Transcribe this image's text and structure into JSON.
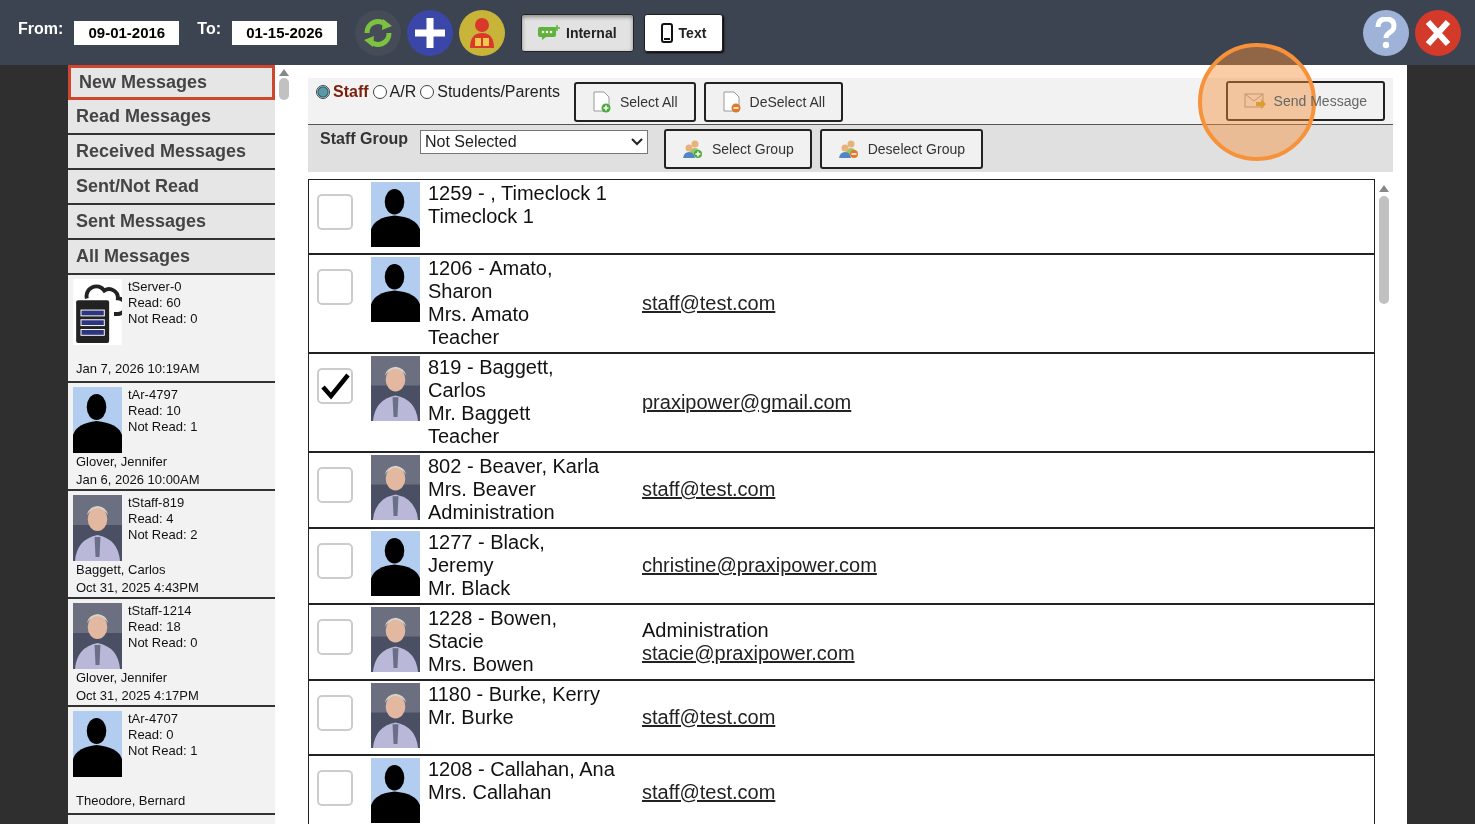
{
  "header": {
    "from_label": "From:",
    "from_date": "09-01-2016",
    "to_label": "To:",
    "to_date": "01-15-2026",
    "modes": [
      {
        "label": "Internal",
        "kind": "chat",
        "selected": true
      },
      {
        "label": "Text",
        "kind": "phone",
        "selected": false
      }
    ]
  },
  "nav": [
    {
      "label": "New Messages",
      "selected": true
    },
    {
      "label": "Read Messages",
      "selected": false
    },
    {
      "label": "Received Messages",
      "selected": false
    },
    {
      "label": "Sent/Not Read",
      "selected": false
    },
    {
      "label": "Sent Messages",
      "selected": false
    },
    {
      "label": "All Messages",
      "selected": false
    }
  ],
  "threads": [
    {
      "kind": "server",
      "id": "tServer-0",
      "read": "Read: 60",
      "not_read": "Not Read: 0",
      "footer": [
        "Jan 7, 2026 10:19AM"
      ]
    },
    {
      "kind": "silhouette",
      "id": "tAr-4797",
      "read": "Read: 10",
      "not_read": "Not Read: 1",
      "footer": [
        "Glover, Jennifer",
        "Jan 6, 2026 10:00AM"
      ]
    },
    {
      "id": "tStaff-819",
      "read": "Read: 4",
      "not_read": "Not Read: 2",
      "footer": [
        "Baggett, Carlos",
        "Oct 31, 2025 4:43PM"
      ]
    },
    {
      "id": "tStaff-1214",
      "read": "Read: 18",
      "not_read": "Not Read: 0",
      "footer": [
        "Glover, Jennifer",
        "Oct 31, 2025 4:17PM"
      ]
    },
    {
      "kind": "silhouette",
      "id": "tAr-4707",
      "read": "Read: 0",
      "not_read": "Not Read: 1",
      "footer": [
        "Theodore, Bernard"
      ]
    }
  ],
  "recipient_types": [
    {
      "label": "Staff",
      "selected": true
    },
    {
      "label": "A/R",
      "selected": false
    },
    {
      "label": "Students/Parents",
      "selected": false
    }
  ],
  "select_all": "Select All",
  "deselect_all": "DeSelect All",
  "send": "Send Message",
  "send_highlighted": true,
  "staff_group_label": "Staff Group",
  "staff_group_value": "Not Selected",
  "select_group": "Select Group",
  "deselect_group": "Deselect Group",
  "contacts": [
    {
      "checked": false,
      "kind": "silhouette",
      "lines": [
        "1259 - , Timeclock 1",
        "Timeclock 1"
      ]
    },
    {
      "checked": false,
      "kind": "silhouette",
      "lines": [
        "1206 - Amato,",
        "Sharon",
        "Mrs. Amato",
        "Teacher"
      ],
      "details": [
        {
          "kind": "link",
          "text": "staff@test.com"
        }
      ]
    },
    {
      "checked": true,
      "lines": [
        "819 - Baggett,",
        "Carlos",
        "Mr. Baggett",
        "Teacher"
      ],
      "details": [
        {
          "kind": "link",
          "text": "praxipower@gmail.com"
        }
      ]
    },
    {
      "checked": false,
      "lines": [
        "802 - Beaver, Karla",
        "Mrs. Beaver",
        "Administration"
      ],
      "details": [
        {
          "kind": "link",
          "text": "staff@test.com"
        }
      ]
    },
    {
      "checked": false,
      "kind": "silhouette",
      "lines": [
        "1277 - Black,",
        "Jeremy",
        "Mr. Black"
      ],
      "details": [
        {
          "kind": "link",
          "text": "christine@praxipower.com"
        }
      ]
    },
    {
      "checked": false,
      "lines": [
        "1228 - Bowen,",
        "Stacie",
        "Mrs. Bowen"
      ],
      "details": [
        {
          "kind": "text",
          "text": "Administration"
        },
        {
          "kind": "link",
          "text": "stacie@praxipower.com"
        }
      ]
    },
    {
      "checked": false,
      "lines": [
        "1180 - Burke, Kerry",
        "Mr. Burke"
      ],
      "details": [
        {
          "kind": "link",
          "text": "staff@test.com"
        }
      ]
    },
    {
      "checked": false,
      "kind": "silhouette",
      "lines": [
        "1208 - Callahan, Ana",
        "Mrs. Callahan"
      ],
      "details": [
        {
          "kind": "link",
          "text": "staff@test.com"
        }
      ]
    }
  ]
}
